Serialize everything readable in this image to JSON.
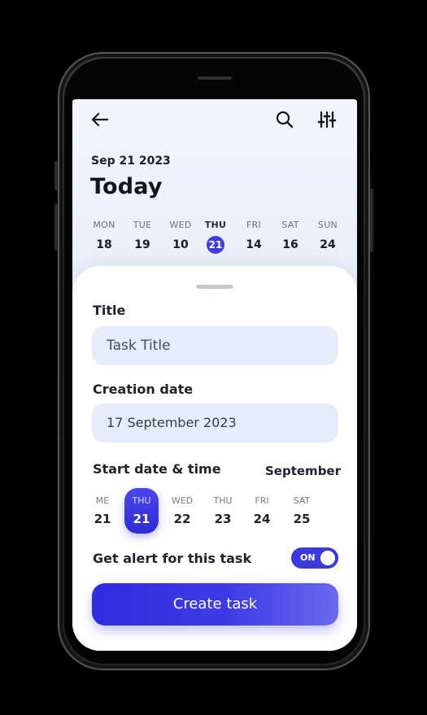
{
  "header": {
    "back_icon": "arrow-left-icon",
    "search_icon": "search-icon",
    "filter_icon": "sliders-icon",
    "date": "Sep 21 2023",
    "title": "Today"
  },
  "week": {
    "days": [
      {
        "name": "MON",
        "num": "18"
      },
      {
        "name": "TUE",
        "num": "19"
      },
      {
        "name": "WED",
        "num": "10"
      },
      {
        "name": "THU",
        "num": "21"
      },
      {
        "name": "FRI",
        "num": "14"
      },
      {
        "name": "SAT",
        "num": "16"
      },
      {
        "name": "SUN",
        "num": "24"
      }
    ],
    "selected_index": 3
  },
  "form": {
    "title_label": "Title",
    "title_placeholder": "Task Title",
    "creation_label": "Creation date",
    "creation_value": "17 September 2023",
    "start_label": "Start date & time",
    "month": "September",
    "picker": [
      {
        "name": "ME",
        "num": "21"
      },
      {
        "name": "THU",
        "num": "21"
      },
      {
        "name": "WED",
        "num": "22"
      },
      {
        "name": "THU",
        "num": "23"
      },
      {
        "name": "FRI",
        "num": "24"
      },
      {
        "name": "SAT",
        "num": "25"
      }
    ],
    "picker_selected_index": 1,
    "alert_label": "Get alert for this task",
    "alert_toggle": "ON",
    "submit_label": "Create task"
  },
  "colors": {
    "accent": "#3f3ce0",
    "field_bg": "#e7ecfb",
    "background": "#000000"
  }
}
